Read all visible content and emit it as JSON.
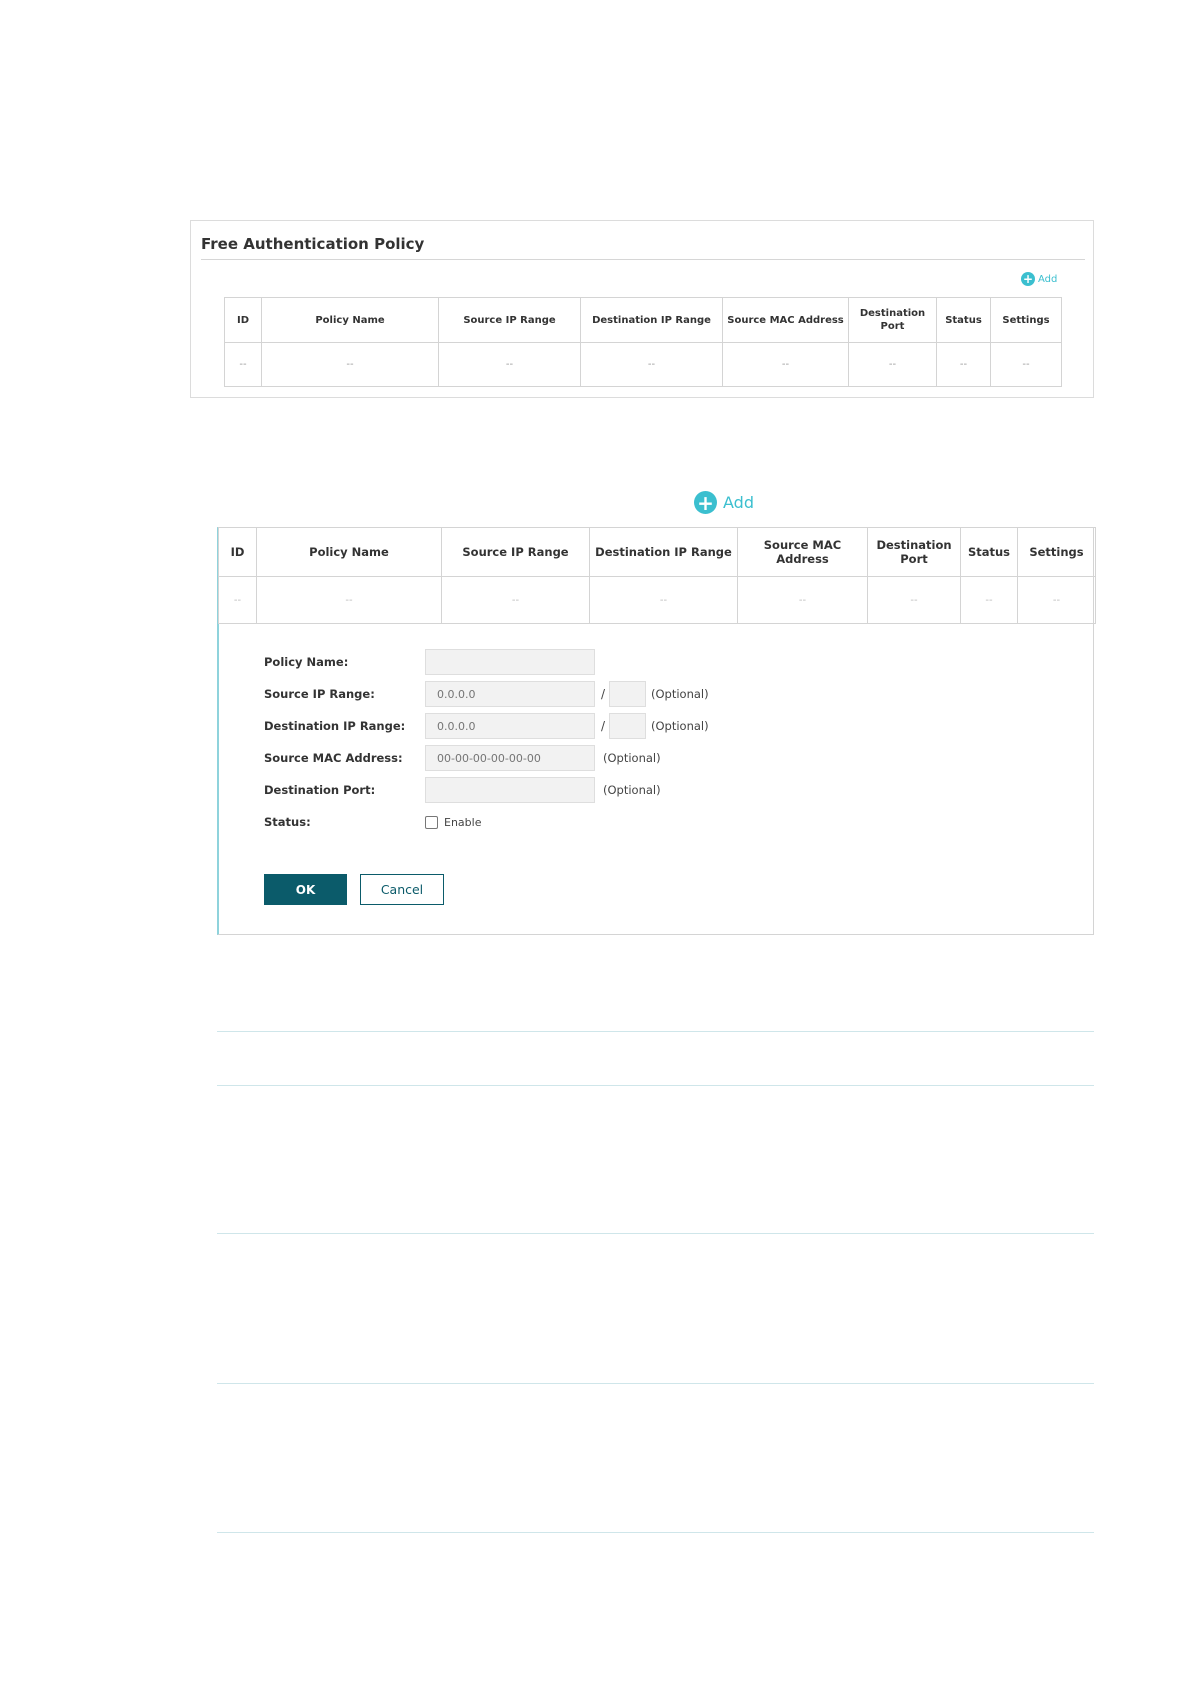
{
  "panel1": {
    "title": "Free Authentication Policy",
    "add_label": "Add",
    "columns": [
      "ID",
      "Policy Name",
      "Source IP Range",
      "Destination IP Range",
      "Source MAC Address",
      "Destination Port",
      "Status",
      "Settings"
    ],
    "row": [
      "--",
      "--",
      "--",
      "--",
      "--",
      "--",
      "--",
      "--"
    ]
  },
  "panel2": {
    "add_label": "Add",
    "columns": [
      "ID",
      "Policy Name",
      "Source IP Range",
      "Destination IP Range",
      "Source MAC Address",
      "Destination Port",
      "Status",
      "Settings"
    ],
    "row": [
      "--",
      "--",
      "--",
      "--",
      "--",
      "--",
      "--",
      "--"
    ],
    "form": {
      "policy_name_label": "Policy Name:",
      "policy_name_value": "",
      "source_ip_label": "Source IP Range:",
      "source_ip_placeholder": "0.0.0.0",
      "source_ip_slash": "/",
      "source_ip_optional": "(Optional)",
      "dest_ip_label": "Destination IP Range:",
      "dest_ip_placeholder": "0.0.0.0",
      "dest_ip_slash": "/",
      "dest_ip_optional": "(Optional)",
      "source_mac_label": "Source MAC Address:",
      "source_mac_placeholder": "00-00-00-00-00-00",
      "source_mac_optional": "(Optional)",
      "dest_port_label": "Destination Port:",
      "dest_port_optional": "(Optional)",
      "status_label": "Status:",
      "enable_label": "Enable",
      "ok_label": "OK",
      "cancel_label": "Cancel"
    }
  },
  "colors": {
    "accent": "#3bbfcf",
    "primary_button": "#0b5b6a"
  }
}
